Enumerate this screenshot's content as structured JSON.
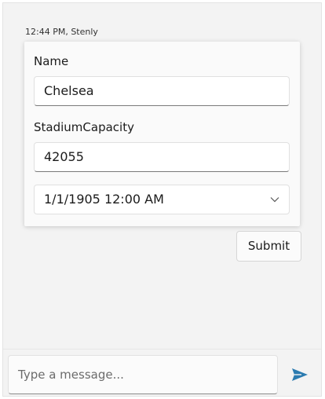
{
  "message": {
    "meta": "12:44 PM, Stenly"
  },
  "form": {
    "name_label": "Name",
    "name_value": "Chelsea",
    "capacity_label": "StadiumCapacity",
    "capacity_value": "42055",
    "date_value": "1/1/1905 12:00 AM",
    "date_icon": "chevron-down-icon"
  },
  "actions": {
    "submit_label": "Submit"
  },
  "composer": {
    "placeholder": "Type a message...",
    "send_icon": "send-icon",
    "accent": "#2b7bb0"
  }
}
